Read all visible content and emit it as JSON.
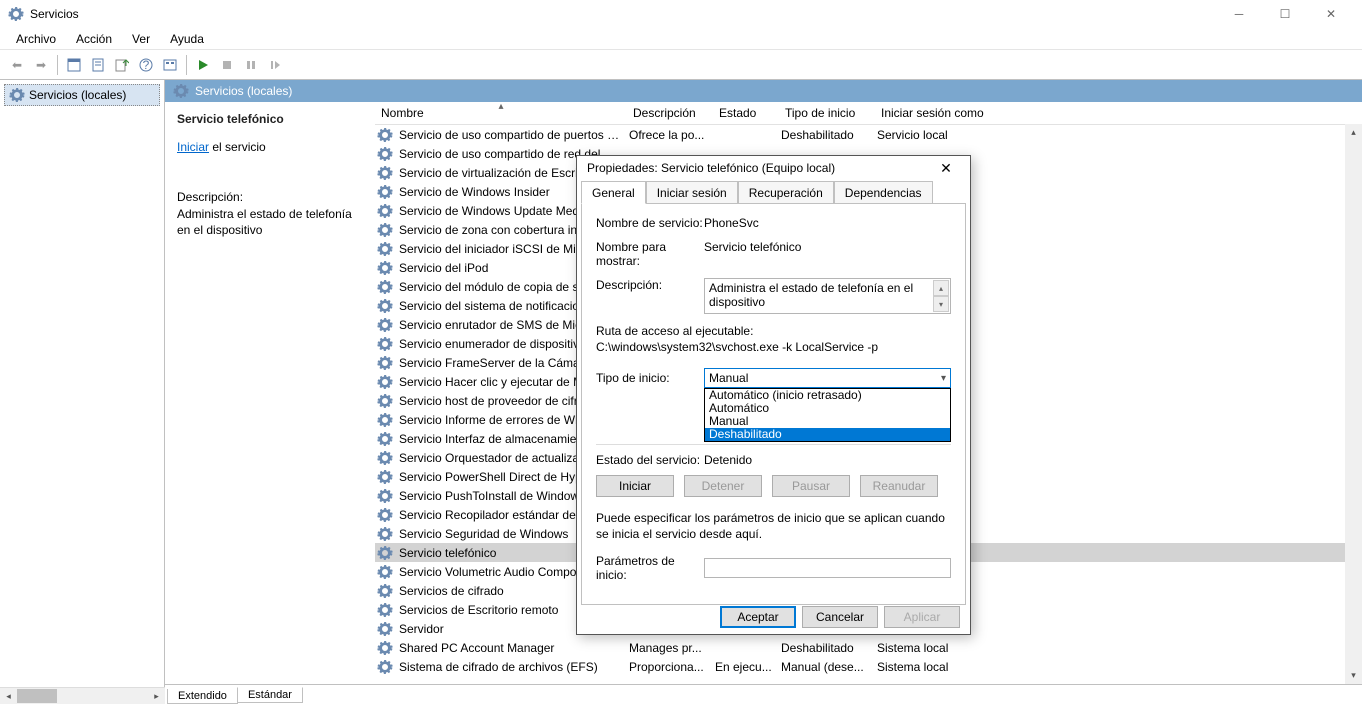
{
  "window": {
    "title": "Servicios"
  },
  "menu": {
    "archivo": "Archivo",
    "accion": "Acción",
    "ver": "Ver",
    "ayuda": "Ayuda"
  },
  "leftPane": {
    "item": "Servicios (locales)"
  },
  "rightHeader": "Servicios (locales)",
  "detail": {
    "title": "Servicio telefónico",
    "linkPrefix": "Iniciar",
    "linkSuffix": " el servicio",
    "descLabel": "Descripción:",
    "descText": "Administra el estado de telefonía en el dispositivo"
  },
  "columns": {
    "name": "Nombre",
    "desc": "Descripción",
    "state": "Estado",
    "start": "Tipo de inicio",
    "logon": "Iniciar sesión como"
  },
  "services": [
    {
      "n": "Servicio de uso compartido de puertos N...",
      "d": "Ofrece la po...",
      "s": "",
      "t": "Deshabilitado",
      "l": "Servicio local"
    },
    {
      "n": "Servicio de uso compartido de red del ...",
      "d": "",
      "s": "",
      "t": "",
      "l": ""
    },
    {
      "n": "Servicio de virtualización de Escritorio ...",
      "d": "",
      "s": "",
      "t": "",
      "l": ""
    },
    {
      "n": "Servicio de Windows Insider",
      "d": "",
      "s": "",
      "t": "",
      "l": ""
    },
    {
      "n": "Servicio de Windows Update Medic",
      "d": "",
      "s": "",
      "t": "",
      "l": ""
    },
    {
      "n": "Servicio de zona con cobertura inalám...",
      "d": "",
      "s": "",
      "t": "",
      "l": ""
    },
    {
      "n": "Servicio del iniciador iSCSI de Microsof...",
      "d": "",
      "s": "",
      "t": "",
      "l": ""
    },
    {
      "n": "Servicio del iPod",
      "d": "",
      "s": "",
      "t": "",
      "l": ""
    },
    {
      "n": "Servicio del módulo de copia de seguri...",
      "d": "",
      "s": "",
      "t": "",
      "l": ""
    },
    {
      "n": "Servicio del sistema de notificaciones ...",
      "d": "",
      "s": "",
      "t": "",
      "l": ""
    },
    {
      "n": "Servicio enrutador de SMS de Microsof...",
      "d": "",
      "s": "",
      "t": "",
      "l": ""
    },
    {
      "n": "Servicio enumerador de dispositivos p...",
      "d": "",
      "s": "",
      "t": "",
      "l": ""
    },
    {
      "n": "Servicio FrameServer de la Cámara de ...",
      "d": "",
      "s": "",
      "t": "",
      "l": ""
    },
    {
      "n": "Servicio Hacer clic y ejecutar de Micros...",
      "d": "",
      "s": "",
      "t": "",
      "l": ""
    },
    {
      "n": "Servicio host de proveedor de cifrado ...",
      "d": "",
      "s": "",
      "t": "",
      "l": ""
    },
    {
      "n": "Servicio Informe de errores de Window...",
      "d": "",
      "s": "",
      "t": "",
      "l": ""
    },
    {
      "n": "Servicio Interfaz de almacenamiento e...",
      "d": "",
      "s": "",
      "t": "",
      "l": ""
    },
    {
      "n": "Servicio Orquestador de actualizacion...",
      "d": "",
      "s": "",
      "t": "",
      "l": ""
    },
    {
      "n": "Servicio PowerShell Direct de Hyper-V",
      "d": "",
      "s": "",
      "t": "",
      "l": ""
    },
    {
      "n": "Servicio PushToInstall de Windows",
      "d": "",
      "s": "",
      "t": "",
      "l": ""
    },
    {
      "n": "Servicio Recopilador estándar del con...",
      "d": "",
      "s": "",
      "t": "",
      "l": ""
    },
    {
      "n": "Servicio Seguridad de Windows",
      "d": "",
      "s": "",
      "t": "",
      "l": ""
    },
    {
      "n": "Servicio telefónico",
      "d": "",
      "s": "",
      "t": "",
      "l": "",
      "sel": true
    },
    {
      "n": "Servicio Volumetric Audio Compositor...",
      "d": "",
      "s": "",
      "t": "",
      "l": ""
    },
    {
      "n": "Servicios de cifrado",
      "d": "",
      "s": "",
      "t": "",
      "l": ""
    },
    {
      "n": "Servicios de Escritorio remoto",
      "d": "",
      "s": "",
      "t": "",
      "l": ""
    },
    {
      "n": "Servidor",
      "d": "",
      "s": "",
      "t": "",
      "l": ""
    },
    {
      "n": "Shared PC Account Manager",
      "d": "Manages pr...",
      "s": "",
      "t": "Deshabilitado",
      "l": "Sistema local"
    },
    {
      "n": "Sistema de cifrado de archivos (EFS)",
      "d": "Proporciona...",
      "s": "En ejecu...",
      "t": "Manual (dese...",
      "l": "Sistema local"
    }
  ],
  "dialog": {
    "title": "Propiedades: Servicio telefónico (Equipo local)",
    "tabs": [
      "General",
      "Iniciar sesión",
      "Recuperación",
      "Dependencias"
    ],
    "labels": {
      "svcName": "Nombre de servicio:",
      "dispName": "Nombre para mostrar:",
      "desc": "Descripción:",
      "pathLabel": "Ruta de acceso al ejecutable:",
      "startType": "Tipo de inicio:",
      "svcState": "Estado del servicio:",
      "paramLabel": "Parámetros de inicio:"
    },
    "values": {
      "svcName": "PhoneSvc",
      "dispName": "Servicio telefónico",
      "desc": "Administra el estado de telefonía en el dispositivo",
      "path": "C:\\windows\\system32\\svchost.exe -k LocalService -p",
      "startType": "Manual",
      "svcState": "Detenido",
      "params": ""
    },
    "dropdown": [
      "Automático (inicio retrasado)",
      "Automático",
      "Manual",
      "Deshabilitado"
    ],
    "buttons": {
      "iniciar": "Iniciar",
      "detener": "Detener",
      "pausar": "Pausar",
      "reanudar": "Reanudar"
    },
    "note": "Puede especificar los parámetros de inicio que se aplican cuando se inicia el servicio desde aquí.",
    "footer": {
      "ok": "Aceptar",
      "cancel": "Cancelar",
      "apply": "Aplicar"
    }
  },
  "bottomTabs": {
    "ext": "Extendido",
    "std": "Estándar"
  }
}
